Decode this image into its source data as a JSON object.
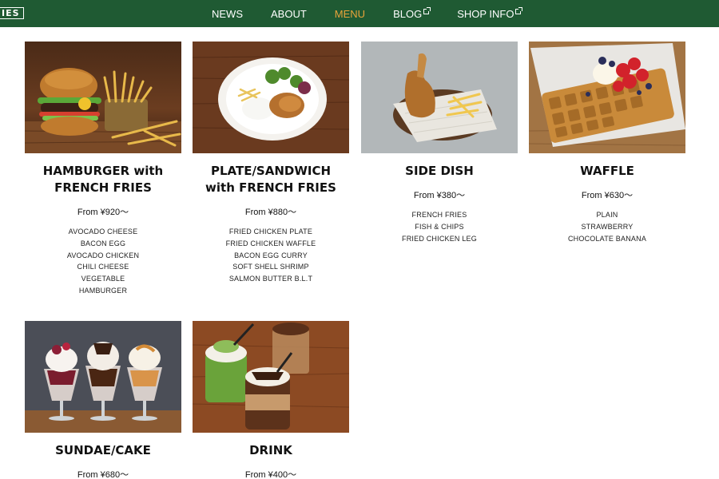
{
  "header": {
    "logo": "IES",
    "nav": [
      {
        "label": "NEWS",
        "external": false,
        "active": false
      },
      {
        "label": "ABOUT",
        "external": false,
        "active": false
      },
      {
        "label": "MENU",
        "external": false,
        "active": true
      },
      {
        "label": "BLOG",
        "external": true,
        "active": false
      },
      {
        "label": "SHOP INFO",
        "external": true,
        "active": false
      }
    ],
    "colors": {
      "background": "#1f5a33",
      "active": "#e8a33a"
    }
  },
  "menu": [
    {
      "title_line1": "HAMBURGER with",
      "title_line2": "FRENCH FRIES",
      "price": "From ¥920～",
      "image_icon": "hamburger-photo",
      "items": [
        "AVOCADO CHEESE",
        "BACON EGG",
        "AVOCADO CHICKEN",
        "CHILI CHEESE",
        "VEGETABLE",
        "HAMBURGER"
      ]
    },
    {
      "title_line1": "PLATE/SANDWICH",
      "title_line2": "with FRENCH FRIES",
      "price": "From ¥880～",
      "image_icon": "plate-photo",
      "items": [
        "FRIED CHICKEN PLATE",
        "FRIED CHICKEN WAFFLE",
        "BACON EGG CURRY",
        "SOFT SHELL SHRIMP",
        "SALMON BUTTER B.L.T"
      ]
    },
    {
      "title_line1": "SIDE DISH",
      "title_line2": "",
      "price": "From ¥380～",
      "image_icon": "side-dish-photo",
      "items": [
        "FRENCH FRIES",
        "FISH & CHIPS",
        "FRIED CHICKEN LEG"
      ]
    },
    {
      "title_line1": "WAFFLE",
      "title_line2": "",
      "price": "From ¥630～",
      "image_icon": "waffle-photo",
      "items": [
        "PLAIN",
        "STRAWBERRY",
        "CHOCOLATE BANANA"
      ]
    },
    {
      "title_line1": "SUNDAE/CAKE",
      "title_line2": "",
      "price": "From ¥680～",
      "image_icon": "sundae-photo",
      "items": []
    },
    {
      "title_line1": "DRINK",
      "title_line2": "",
      "price": "From ¥400～",
      "image_icon": "drink-photo",
      "items": []
    }
  ]
}
